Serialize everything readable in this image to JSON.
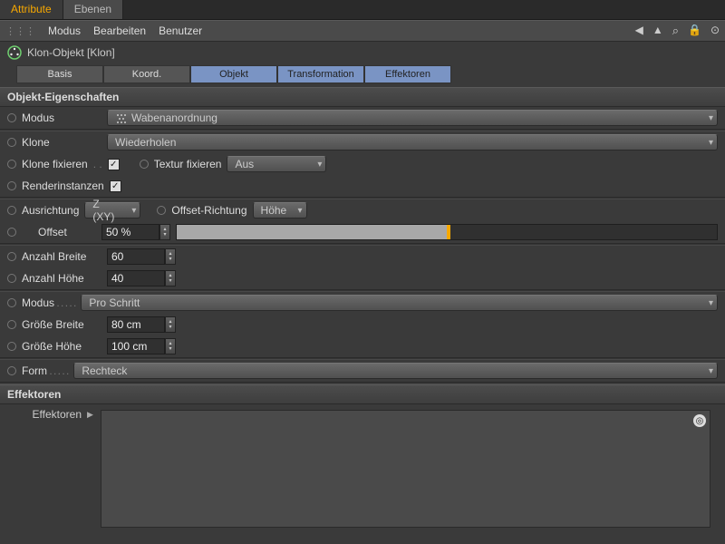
{
  "topTabs": {
    "active": "Attribute",
    "inactive": "Ebenen"
  },
  "menu": {
    "modus": "Modus",
    "bearbeiten": "Bearbeiten",
    "benutzer": "Benutzer"
  },
  "objTitle": "Klon-Objekt [Klon]",
  "propTabs": {
    "basis": "Basis",
    "koord": "Koord.",
    "objekt": "Objekt",
    "transformation": "Transformation",
    "effektoren": "Effektoren"
  },
  "sections": {
    "objProps": "Objekt-Eigenschaften",
    "effektoren": "Effektoren"
  },
  "rows": {
    "modus": {
      "label": "Modus",
      "value": "Wabenanordnung"
    },
    "klone": {
      "label": "Klone",
      "value": "Wiederholen"
    },
    "kloneFix": {
      "label": "Klone fixieren",
      "checked": true
    },
    "texturFix": {
      "label": "Textur fixieren",
      "value": "Aus"
    },
    "renderInst": {
      "label": "Renderinstanzen",
      "checked": true
    },
    "ausrichtung": {
      "label": "Ausrichtung",
      "value": "Z (XY)"
    },
    "offsetRichtung": {
      "label": "Offset-Richtung",
      "value": "Höhe"
    },
    "offset": {
      "label": "Offset",
      "value": "50 %",
      "percent": 50
    },
    "anzBreite": {
      "label": "Anzahl Breite",
      "value": "60"
    },
    "anzHoehe": {
      "label": "Anzahl Höhe",
      "value": "40"
    },
    "modus2": {
      "label": "Modus",
      "value": "Pro Schritt"
    },
    "grBreite": {
      "label": "Größe Breite",
      "value": "80 cm"
    },
    "grHoehe": {
      "label": "Größe Höhe",
      "value": "100 cm"
    },
    "form": {
      "label": "Form",
      "value": "Rechteck"
    },
    "effLabel": "Effektoren"
  }
}
